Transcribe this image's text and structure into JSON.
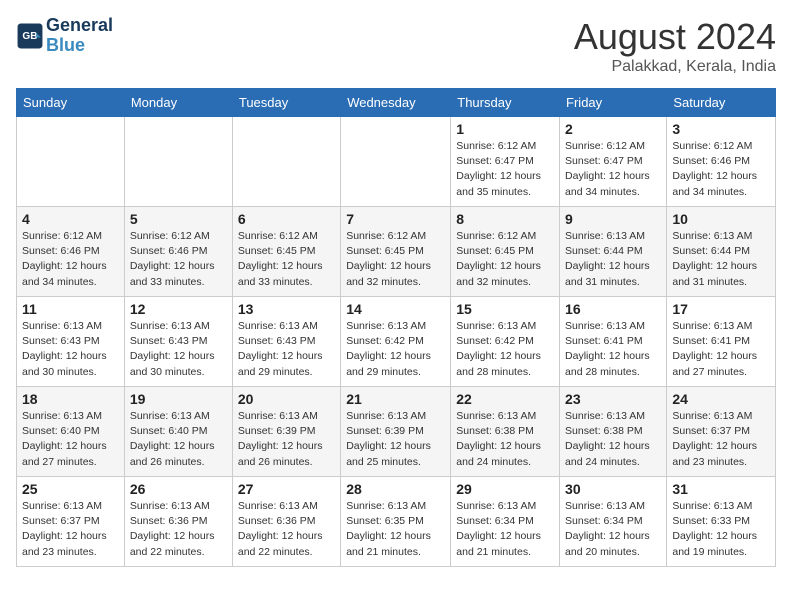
{
  "header": {
    "logo_line1": "General",
    "logo_line2": "Blue",
    "month_title": "August 2024",
    "subtitle": "Palakkad, Kerala, India"
  },
  "weekdays": [
    "Sunday",
    "Monday",
    "Tuesday",
    "Wednesday",
    "Thursday",
    "Friday",
    "Saturday"
  ],
  "weeks": [
    [
      {
        "day": "",
        "info": ""
      },
      {
        "day": "",
        "info": ""
      },
      {
        "day": "",
        "info": ""
      },
      {
        "day": "",
        "info": ""
      },
      {
        "day": "1",
        "info": "Sunrise: 6:12 AM\nSunset: 6:47 PM\nDaylight: 12 hours\nand 35 minutes."
      },
      {
        "day": "2",
        "info": "Sunrise: 6:12 AM\nSunset: 6:47 PM\nDaylight: 12 hours\nand 34 minutes."
      },
      {
        "day": "3",
        "info": "Sunrise: 6:12 AM\nSunset: 6:46 PM\nDaylight: 12 hours\nand 34 minutes."
      }
    ],
    [
      {
        "day": "4",
        "info": "Sunrise: 6:12 AM\nSunset: 6:46 PM\nDaylight: 12 hours\nand 34 minutes."
      },
      {
        "day": "5",
        "info": "Sunrise: 6:12 AM\nSunset: 6:46 PM\nDaylight: 12 hours\nand 33 minutes."
      },
      {
        "day": "6",
        "info": "Sunrise: 6:12 AM\nSunset: 6:45 PM\nDaylight: 12 hours\nand 33 minutes."
      },
      {
        "day": "7",
        "info": "Sunrise: 6:12 AM\nSunset: 6:45 PM\nDaylight: 12 hours\nand 32 minutes."
      },
      {
        "day": "8",
        "info": "Sunrise: 6:12 AM\nSunset: 6:45 PM\nDaylight: 12 hours\nand 32 minutes."
      },
      {
        "day": "9",
        "info": "Sunrise: 6:13 AM\nSunset: 6:44 PM\nDaylight: 12 hours\nand 31 minutes."
      },
      {
        "day": "10",
        "info": "Sunrise: 6:13 AM\nSunset: 6:44 PM\nDaylight: 12 hours\nand 31 minutes."
      }
    ],
    [
      {
        "day": "11",
        "info": "Sunrise: 6:13 AM\nSunset: 6:43 PM\nDaylight: 12 hours\nand 30 minutes."
      },
      {
        "day": "12",
        "info": "Sunrise: 6:13 AM\nSunset: 6:43 PM\nDaylight: 12 hours\nand 30 minutes."
      },
      {
        "day": "13",
        "info": "Sunrise: 6:13 AM\nSunset: 6:43 PM\nDaylight: 12 hours\nand 29 minutes."
      },
      {
        "day": "14",
        "info": "Sunrise: 6:13 AM\nSunset: 6:42 PM\nDaylight: 12 hours\nand 29 minutes."
      },
      {
        "day": "15",
        "info": "Sunrise: 6:13 AM\nSunset: 6:42 PM\nDaylight: 12 hours\nand 28 minutes."
      },
      {
        "day": "16",
        "info": "Sunrise: 6:13 AM\nSunset: 6:41 PM\nDaylight: 12 hours\nand 28 minutes."
      },
      {
        "day": "17",
        "info": "Sunrise: 6:13 AM\nSunset: 6:41 PM\nDaylight: 12 hours\nand 27 minutes."
      }
    ],
    [
      {
        "day": "18",
        "info": "Sunrise: 6:13 AM\nSunset: 6:40 PM\nDaylight: 12 hours\nand 27 minutes."
      },
      {
        "day": "19",
        "info": "Sunrise: 6:13 AM\nSunset: 6:40 PM\nDaylight: 12 hours\nand 26 minutes."
      },
      {
        "day": "20",
        "info": "Sunrise: 6:13 AM\nSunset: 6:39 PM\nDaylight: 12 hours\nand 26 minutes."
      },
      {
        "day": "21",
        "info": "Sunrise: 6:13 AM\nSunset: 6:39 PM\nDaylight: 12 hours\nand 25 minutes."
      },
      {
        "day": "22",
        "info": "Sunrise: 6:13 AM\nSunset: 6:38 PM\nDaylight: 12 hours\nand 24 minutes."
      },
      {
        "day": "23",
        "info": "Sunrise: 6:13 AM\nSunset: 6:38 PM\nDaylight: 12 hours\nand 24 minutes."
      },
      {
        "day": "24",
        "info": "Sunrise: 6:13 AM\nSunset: 6:37 PM\nDaylight: 12 hours\nand 23 minutes."
      }
    ],
    [
      {
        "day": "25",
        "info": "Sunrise: 6:13 AM\nSunset: 6:37 PM\nDaylight: 12 hours\nand 23 minutes."
      },
      {
        "day": "26",
        "info": "Sunrise: 6:13 AM\nSunset: 6:36 PM\nDaylight: 12 hours\nand 22 minutes."
      },
      {
        "day": "27",
        "info": "Sunrise: 6:13 AM\nSunset: 6:36 PM\nDaylight: 12 hours\nand 22 minutes."
      },
      {
        "day": "28",
        "info": "Sunrise: 6:13 AM\nSunset: 6:35 PM\nDaylight: 12 hours\nand 21 minutes."
      },
      {
        "day": "29",
        "info": "Sunrise: 6:13 AM\nSunset: 6:34 PM\nDaylight: 12 hours\nand 21 minutes."
      },
      {
        "day": "30",
        "info": "Sunrise: 6:13 AM\nSunset: 6:34 PM\nDaylight: 12 hours\nand 20 minutes."
      },
      {
        "day": "31",
        "info": "Sunrise: 6:13 AM\nSunset: 6:33 PM\nDaylight: 12 hours\nand 19 minutes."
      }
    ]
  ]
}
